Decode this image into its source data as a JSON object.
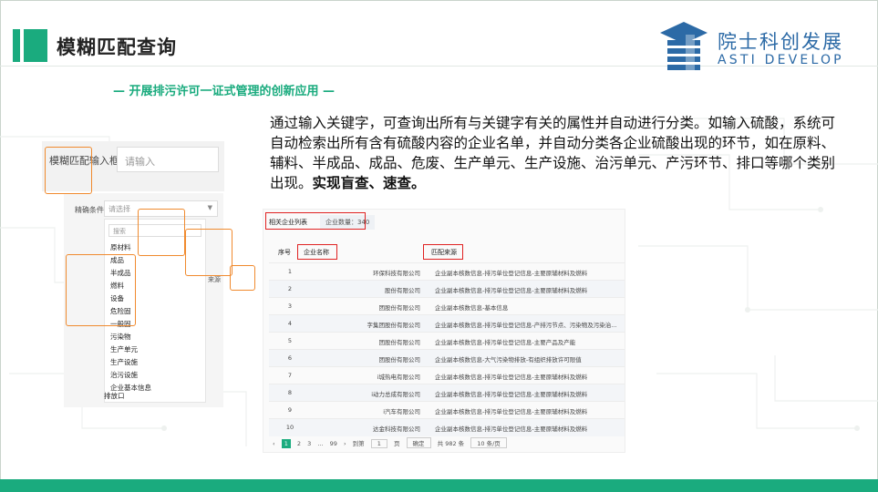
{
  "header": {
    "title": "模糊匹配查询",
    "logo_cn": "院士科创发展",
    "logo_en": "ASTI DEVELOP",
    "accent_color": "#1aab7e",
    "logo_color": "#2c6aa6"
  },
  "subtitle": "— 开展排污许可一证式管理的创新应用 —",
  "description": {
    "text": "通过输入关键字，可查询出所有与关键字有关的属性并自动进行分类。如输入硫酸，系统可自动检索出所有含有硫酸内容的企业名单，并自动分类各企业硫酸出现的环节，如在原料、辅料、半成品、成品、危废、生产单元、生产设施、治污单元、产污环节、排口等哪个类别出现。",
    "bold": "实现盲查、速查。"
  },
  "fuzzy_input": {
    "label": "模糊匹配输入框",
    "placeholder": "请输入"
  },
  "dropdown": {
    "label": "精确条件",
    "placeholder": "请选择",
    "search_placeholder": "搜索",
    "options": [
      "原材料",
      "成品",
      "半成品",
      "燃料",
      "设备",
      "危险固",
      "一般固",
      "污染物",
      "生产单元",
      "生产设施",
      "治污设施",
      "企业基本信息",
      "排放口"
    ],
    "side_label": "来源"
  },
  "table": {
    "tab_label": "相关企业列表",
    "count_badge": "企业数量：340",
    "columns": [
      "序号",
      "企业名称",
      "匹配来源"
    ],
    "rows": [
      {
        "no": "1",
        "name": "环保科技有限公司",
        "source": "企业副本核数信息-排污单位登记信息-主要原辅材料及燃料"
      },
      {
        "no": "2",
        "name": "股份有限公司",
        "source": "企业副本核数信息-排污单位登记信息-主要原辅材料及燃料"
      },
      {
        "no": "3",
        "name": "团股份有限公司",
        "source": "企业副本核数信息-基本信息"
      },
      {
        "no": "4",
        "name": "字集团股份有限公司",
        "source": "企业副本核数信息-排污单位登记信息-产排污节点、污染物及污染治..."
      },
      {
        "no": "5",
        "name": "团股份有限公司",
        "source": "企业副本核数信息-排污单位登记信息-主要产品及产能"
      },
      {
        "no": "6",
        "name": "团股份有限公司",
        "source": "企业副本核数信息-大气污染物排放-有组织排放许可限值"
      },
      {
        "no": "7",
        "name": "i城热电有限公司",
        "source": "企业副本核数信息-排污单位登记信息-主要原辅材料及燃料"
      },
      {
        "no": "8",
        "name": "i动力总成有限公司",
        "source": "企业副本核数信息-排污单位登记信息-主要原辅材料及燃料"
      },
      {
        "no": "9",
        "name": "i汽车有限公司",
        "source": "企业副本核数信息-排污单位登记信息-主要原辅材料及燃料"
      },
      {
        "no": "10",
        "name": "达金科技有限公司",
        "source": "企业副本核数信息-排污单位登记信息-主要原辅材料及燃料"
      }
    ],
    "pager": {
      "prev": "‹",
      "pages": [
        "1",
        "2",
        "3",
        "...",
        "99"
      ],
      "next": "›",
      "goto_label": "到第",
      "goto_value": "1",
      "page_unit": "页",
      "confirm": "确定",
      "total": "共 982 条",
      "page_size": "10 条/页"
    }
  }
}
